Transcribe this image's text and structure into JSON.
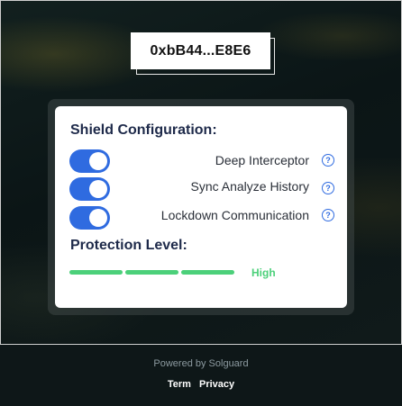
{
  "wallet": {
    "address": "0xbB44...E8E6"
  },
  "shield": {
    "title": "Shield Configuration:",
    "options": [
      {
        "label": "Deep Interceptor",
        "enabled": true,
        "help_icon": "question-circle-icon"
      },
      {
        "label": "Sync Analyze History",
        "enabled": true,
        "help_icon": "question-circle-icon"
      },
      {
        "label": "Lockdown Communication",
        "enabled": true,
        "help_icon": "question-circle-icon"
      }
    ]
  },
  "protection": {
    "title": "Protection Level:",
    "level_text": "High",
    "level_fraction": 1.0,
    "color": "#4cd07a"
  },
  "footer": {
    "powered_by": "Powered by Solguard",
    "links": [
      "Term",
      "Privacy"
    ]
  },
  "colors": {
    "accent": "#2f6be0",
    "success": "#4cd07a",
    "background": "#0e1718"
  }
}
